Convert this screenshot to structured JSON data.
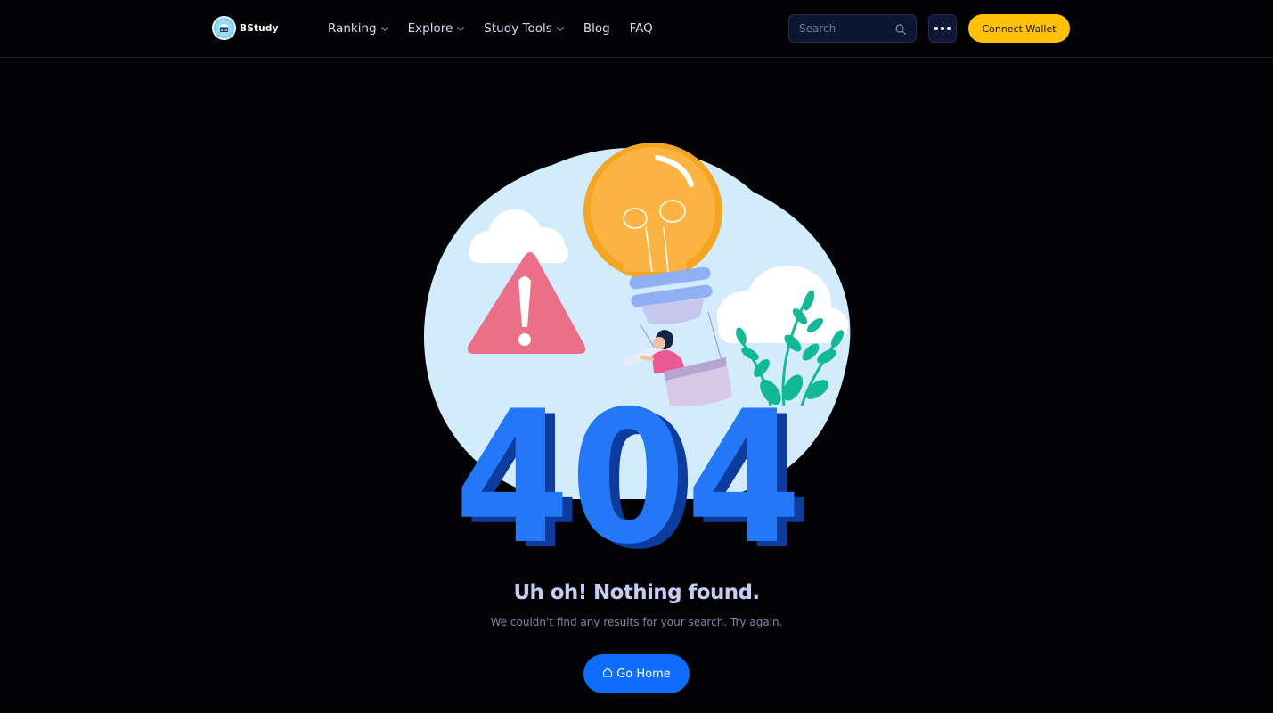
{
  "header": {
    "brand": "BStudy",
    "nav": [
      {
        "label": "Ranking",
        "dropdown": true
      },
      {
        "label": "Explore",
        "dropdown": true
      },
      {
        "label": "Study Tools",
        "dropdown": true
      },
      {
        "label": "Blog",
        "dropdown": false
      },
      {
        "label": "FAQ",
        "dropdown": false
      }
    ],
    "search_placeholder": "Search",
    "search_icon": "magnifier-icon",
    "more_icon": "ellipsis-icon",
    "connect_wallet_label": "Connect Wallet"
  },
  "illustration": {
    "code": "404"
  },
  "message": {
    "title": "Uh oh! Nothing found.",
    "subtitle": "We couldn't find any results for your search. Try again.",
    "home_button_label": "Go Home",
    "home_icon": "house-icon"
  },
  "colors": {
    "background": "#030305",
    "accent_yellow": "#ffc107",
    "primary_blue": "#0d6efd",
    "digits_blue": "#1f6ef5"
  }
}
